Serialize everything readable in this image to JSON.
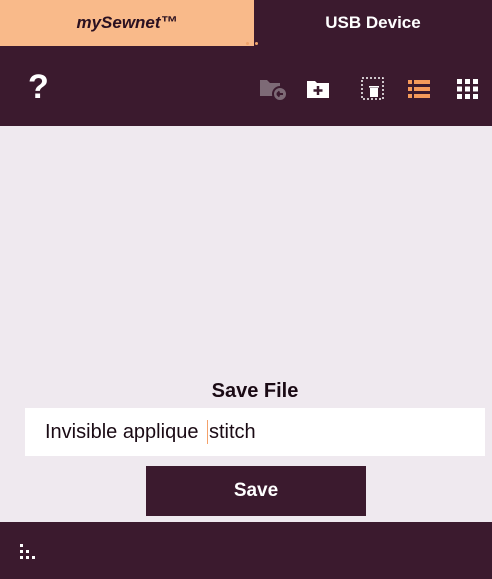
{
  "tabs": [
    {
      "label": "mySewnet™",
      "active": true
    },
    {
      "label": "USB Device",
      "active": false
    }
  ],
  "toolbar": {
    "help_label": "?",
    "icons": [
      "folder-back-icon",
      "new-folder-icon",
      "delete-selection-icon",
      "list-view-icon",
      "grid-view-icon"
    ]
  },
  "save": {
    "title": "Save File",
    "filename_before_cursor": "Invisible applique ",
    "filename_after_cursor": "stitch",
    "button_label": "Save"
  },
  "colors": {
    "dark": "#3b1a2e",
    "accent": "#f9ba8a",
    "background": "#efe9ef"
  }
}
